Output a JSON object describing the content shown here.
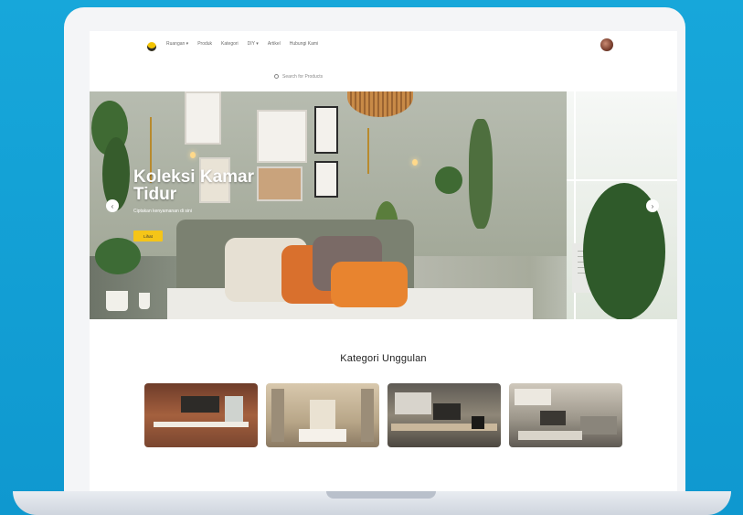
{
  "nav": {
    "menu": [
      "Ruangan ▾",
      "Produk",
      "Kategori",
      "DIY ▾",
      "Artikel",
      "Hubungi Kami"
    ]
  },
  "search": {
    "placeholder": "Search for Products"
  },
  "hero": {
    "title": "Koleksi Kamar Tidur",
    "subtitle": "Ciptakan kenyamanan di sini",
    "button_label": "Lihat",
    "prev_icon": "‹",
    "next_icon": "›"
  },
  "categories": {
    "title": "Kategori Unggulan"
  },
  "colors": {
    "background": "#129fd5",
    "accent": "#f5c518",
    "screen": "#ffffff"
  }
}
